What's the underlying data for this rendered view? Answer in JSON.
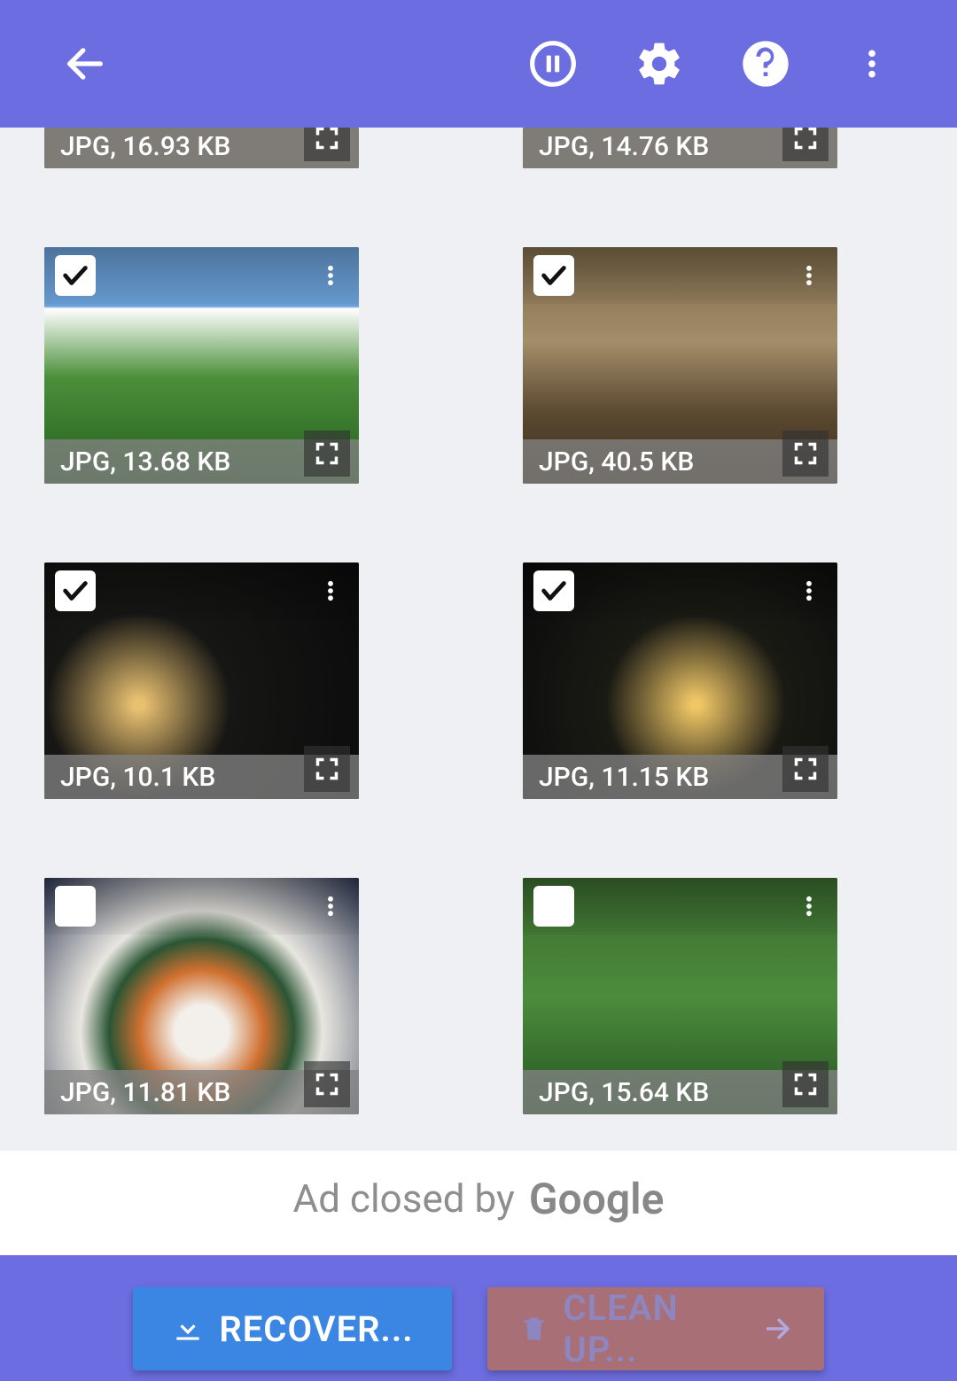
{
  "tiles": [
    {
      "label": "JPG, 16.93 KB",
      "checked": true,
      "format": "JPG",
      "size_kb": 16.93
    },
    {
      "label": "JPG, 14.76 KB",
      "checked": true,
      "format": "JPG",
      "size_kb": 14.76
    },
    {
      "label": "JPG, 13.68 KB",
      "checked": true,
      "format": "JPG",
      "size_kb": 13.68
    },
    {
      "label": "JPG, 40.5 KB",
      "checked": true,
      "format": "JPG",
      "size_kb": 40.5
    },
    {
      "label": "JPG, 10.1 KB",
      "checked": true,
      "format": "JPG",
      "size_kb": 10.1
    },
    {
      "label": "JPG, 11.15 KB",
      "checked": true,
      "format": "JPG",
      "size_kb": 11.15
    },
    {
      "label": "JPG, 11.81 KB",
      "checked": false,
      "format": "JPG",
      "size_kb": 11.81
    },
    {
      "label": "JPG, 15.64 KB",
      "checked": false,
      "format": "JPG",
      "size_kb": 15.64
    }
  ],
  "ad": {
    "prefix": "Ad closed by ",
    "brand": "Google"
  },
  "buttons": {
    "recover": "RECOVER...",
    "cleanup": "CLEAN UP..."
  }
}
